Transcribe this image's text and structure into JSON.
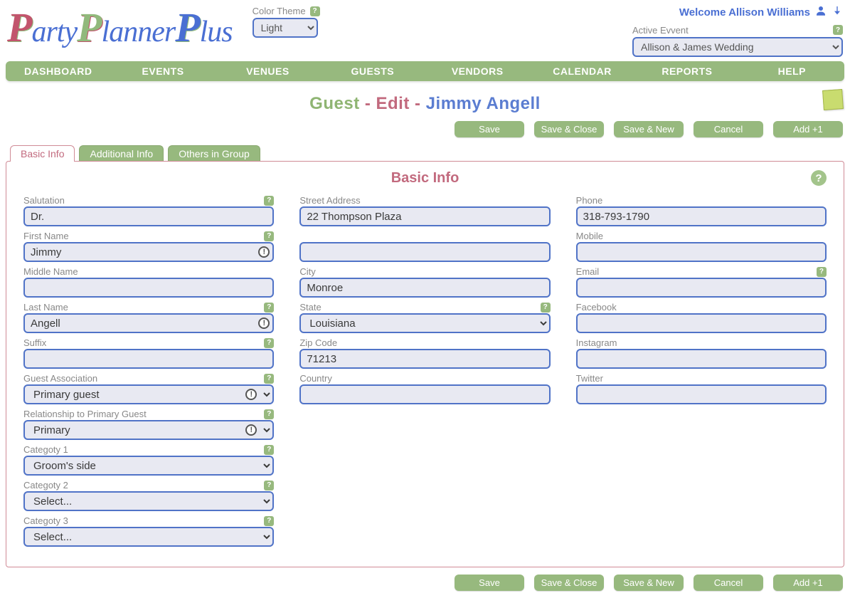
{
  "header": {
    "color_theme_label": "Color Theme",
    "color_theme_value": "Light",
    "welcome_text": "Welcome Allison Williams",
    "active_event_label": "Active Evvent",
    "active_event_value": "Allison & James Wedding"
  },
  "nav": {
    "items": [
      "DASHBOARD",
      "EVENTS",
      "VENUES",
      "GUESTS",
      "VENDORS",
      "CALENDAR",
      "REPORTS",
      "HELP"
    ]
  },
  "page": {
    "title_prefix": "Guest",
    "title_mid": " - Edit - ",
    "title_name": "Jimmy Angell"
  },
  "buttons": {
    "save": "Save",
    "save_close": "Save & Close",
    "save_new": "Save & New",
    "cancel": "Cancel",
    "add1": "Add +1"
  },
  "tabs": {
    "basic": "Basic Info",
    "additional": "Additional Info",
    "others": "Others in Group"
  },
  "panel": {
    "title": "Basic Info"
  },
  "labels": {
    "salutation": "Salutation",
    "first_name": "First Name",
    "middle_name": "Middle Name",
    "last_name": "Last Name",
    "suffix": "Suffix",
    "guest_assoc": "Guest Association",
    "relationship": "Relationship to Primary Guest",
    "category1": "Categoty 1",
    "category2": "Categoty 2",
    "category3": "Categoty 3",
    "street": "Street Address",
    "street2": "",
    "city": "City",
    "state": "State",
    "zip": "Zip Code",
    "country": "Country",
    "phone": "Phone",
    "mobile": "Mobile",
    "email": "Email",
    "facebook": "Facebook",
    "instagram": "Instagram",
    "twitter": "Twitter"
  },
  "values": {
    "salutation": "Dr.",
    "first_name": "Jimmy",
    "middle_name": "",
    "last_name": "Angell",
    "suffix": "",
    "guest_assoc": "Primary guest",
    "relationship": "Primary",
    "category1": "Groom's side",
    "category2": "Select...",
    "category3": "Select...",
    "street": "22 Thompson Plaza",
    "street2": "",
    "city": "Monroe",
    "state": "Louisiana",
    "zip": "71213",
    "country": "",
    "phone": "318-793-1790",
    "mobile": "",
    "email": "",
    "facebook": "",
    "instagram": "",
    "twitter": ""
  },
  "glyphs": {
    "help": "?",
    "required": "!",
    "user": "👤",
    "arrow_down": "↓"
  }
}
